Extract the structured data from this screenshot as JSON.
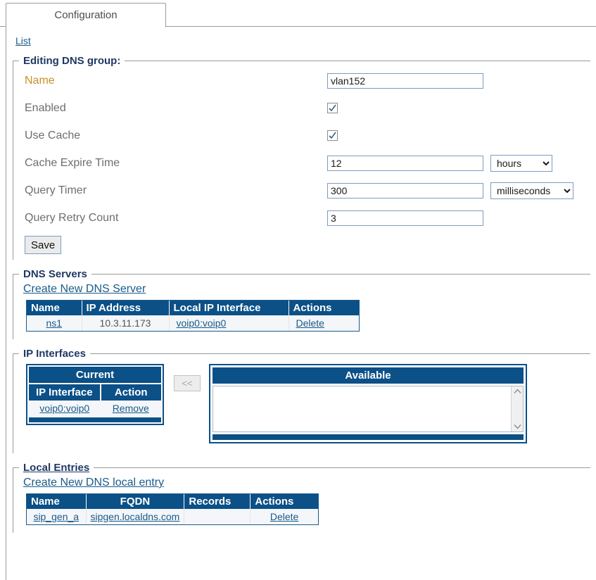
{
  "tab": {
    "label": "Configuration"
  },
  "breadcrumb": {
    "list_label": "List"
  },
  "editing": {
    "legend": "Editing DNS group:",
    "fields": {
      "name": {
        "label": "Name",
        "value": "vlan152"
      },
      "enabled": {
        "label": "Enabled",
        "checked": "true"
      },
      "use_cache": {
        "label": "Use Cache",
        "checked": "true"
      },
      "cache_expire_time": {
        "label": "Cache Expire Time",
        "value": "12",
        "unit": "hours"
      },
      "query_timer": {
        "label": "Query Timer",
        "value": "300",
        "unit": "milliseconds"
      },
      "query_retry_count": {
        "label": "Query Retry Count",
        "value": "3"
      }
    },
    "save_label": "Save"
  },
  "dns_servers": {
    "legend": "DNS Servers",
    "create_link": "Create New DNS Server",
    "columns": [
      "Name",
      "IP Address",
      "Local IP Interface",
      "Actions"
    ],
    "rows": [
      {
        "name": "ns1",
        "ip_address": "10.3.11.173",
        "local_ip_interface": "voip0:voip0",
        "action": "Delete"
      }
    ]
  },
  "ip_interfaces": {
    "legend": "IP Interfaces",
    "current": {
      "title": "Current",
      "columns": [
        "IP Interface",
        "Action"
      ],
      "rows": [
        {
          "ip_interface": "voip0:voip0",
          "action": "Remove"
        }
      ]
    },
    "move_button": "<<",
    "available": {
      "title": "Available",
      "items": []
    }
  },
  "local_entries": {
    "legend": "Local Entries",
    "create_link": "Create New DNS local entry",
    "columns": [
      "Name",
      "FQDN",
      "Records",
      "Actions"
    ],
    "rows": [
      {
        "name": "sip_gen_a",
        "fqdn": "sipgen.localdns.com",
        "records": "",
        "action": "Delete"
      }
    ]
  },
  "colors": {
    "header_blue": "#0b5087",
    "link_blue": "#1a5b8a",
    "legend_navy": "#1f3864",
    "required_label": "#c8922a",
    "label_gray": "#6e6e6e"
  }
}
